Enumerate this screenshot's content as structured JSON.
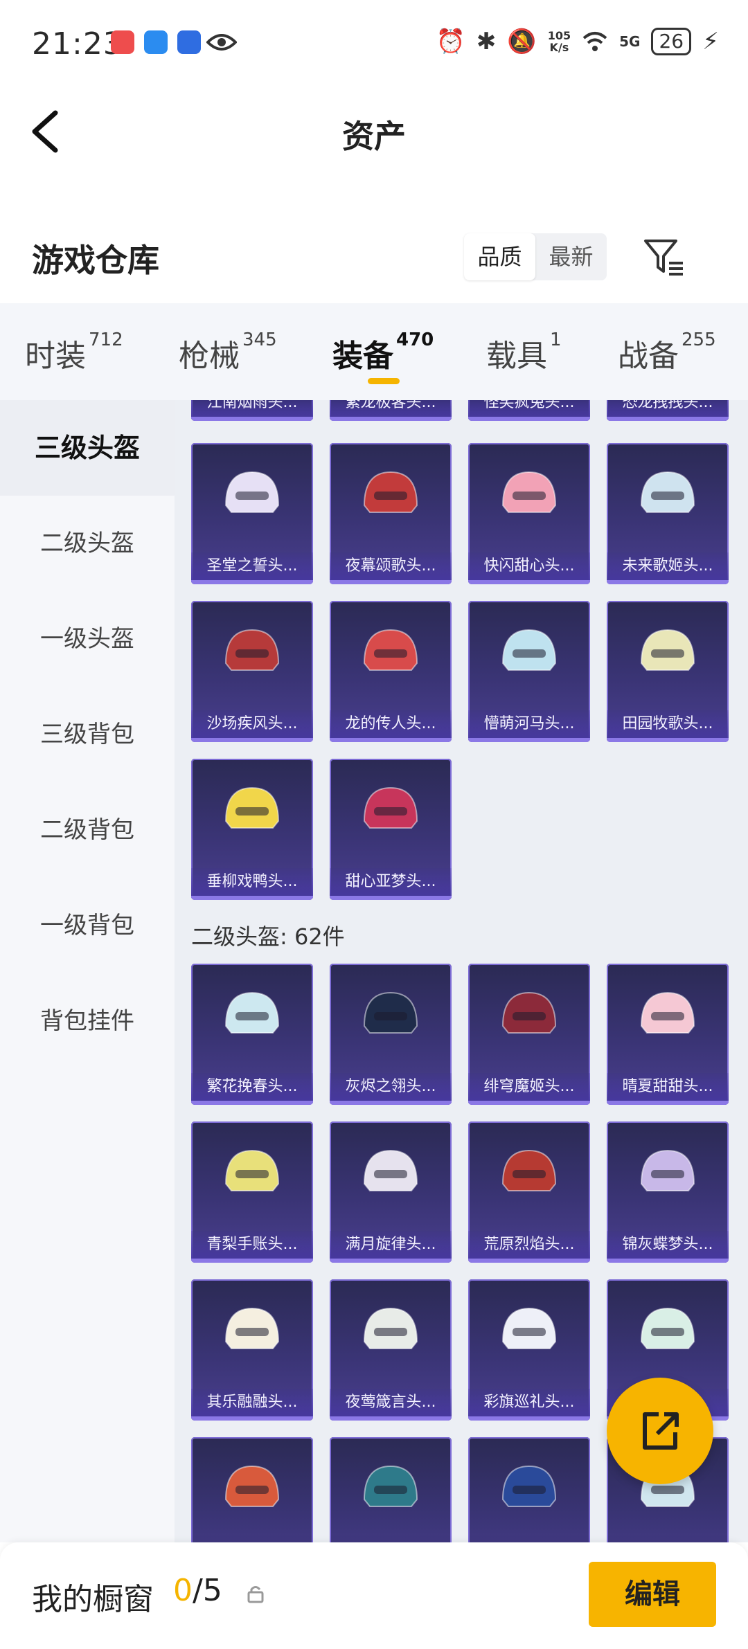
{
  "status_bar": {
    "time": "21:23",
    "speed_value": "105",
    "speed_unit": "K/s",
    "network": "5G",
    "battery": "26"
  },
  "header": {
    "title": "资产"
  },
  "section": {
    "title": "游戏仓库",
    "sort_options": [
      "品质",
      "最新"
    ]
  },
  "tabs": [
    {
      "label": "时装",
      "count": "712"
    },
    {
      "label": "枪械",
      "count": "345"
    },
    {
      "label": "装备",
      "count": "470"
    },
    {
      "label": "载具",
      "count": "1"
    },
    {
      "label": "战备",
      "count": "255"
    }
  ],
  "sidebar": [
    "三级头盔",
    "二级头盔",
    "一级头盔",
    "三级背包",
    "二级背包",
    "一级背包",
    "背包挂件"
  ],
  "groups": {
    "level3": {
      "partial_items": [
        "江南烟雨头...",
        "繁龙极客头...",
        "怪笑疯兔头...",
        "恐龙拽拽头..."
      ],
      "items": [
        "圣堂之誓头...",
        "夜幕颂歌头...",
        "快闪甜心头...",
        "未来歌姬头...",
        "沙场疾风头...",
        "龙的传人头...",
        "懵萌河马头...",
        "田园牧歌头...",
        "垂柳戏鸭头...",
        "甜心亚梦头..."
      ]
    },
    "level2": {
      "label": "二级头盔: 62件",
      "items": [
        "繁花挽春头...",
        "灰烬之翎头...",
        "绯穹魔姬头...",
        "晴夏甜甜头...",
        "青梨手账头...",
        "满月旋律头...",
        "荒原烈焰头...",
        "锦灰蝶梦头...",
        "其乐融融头...",
        "夜莺箴言头...",
        "彩旗巡礼头...",
        "",
        "",
        "",
        "",
        ""
      ]
    }
  },
  "bottom": {
    "window_label": "我的橱窗",
    "count_current": "0",
    "count_total": "/5",
    "edit_label": "编辑"
  },
  "colors": {
    "accent": "#f5b400",
    "card_top": "#2b2a54",
    "card_bottom": "#4a3f8f",
    "card_border": "#7d6cd6"
  }
}
